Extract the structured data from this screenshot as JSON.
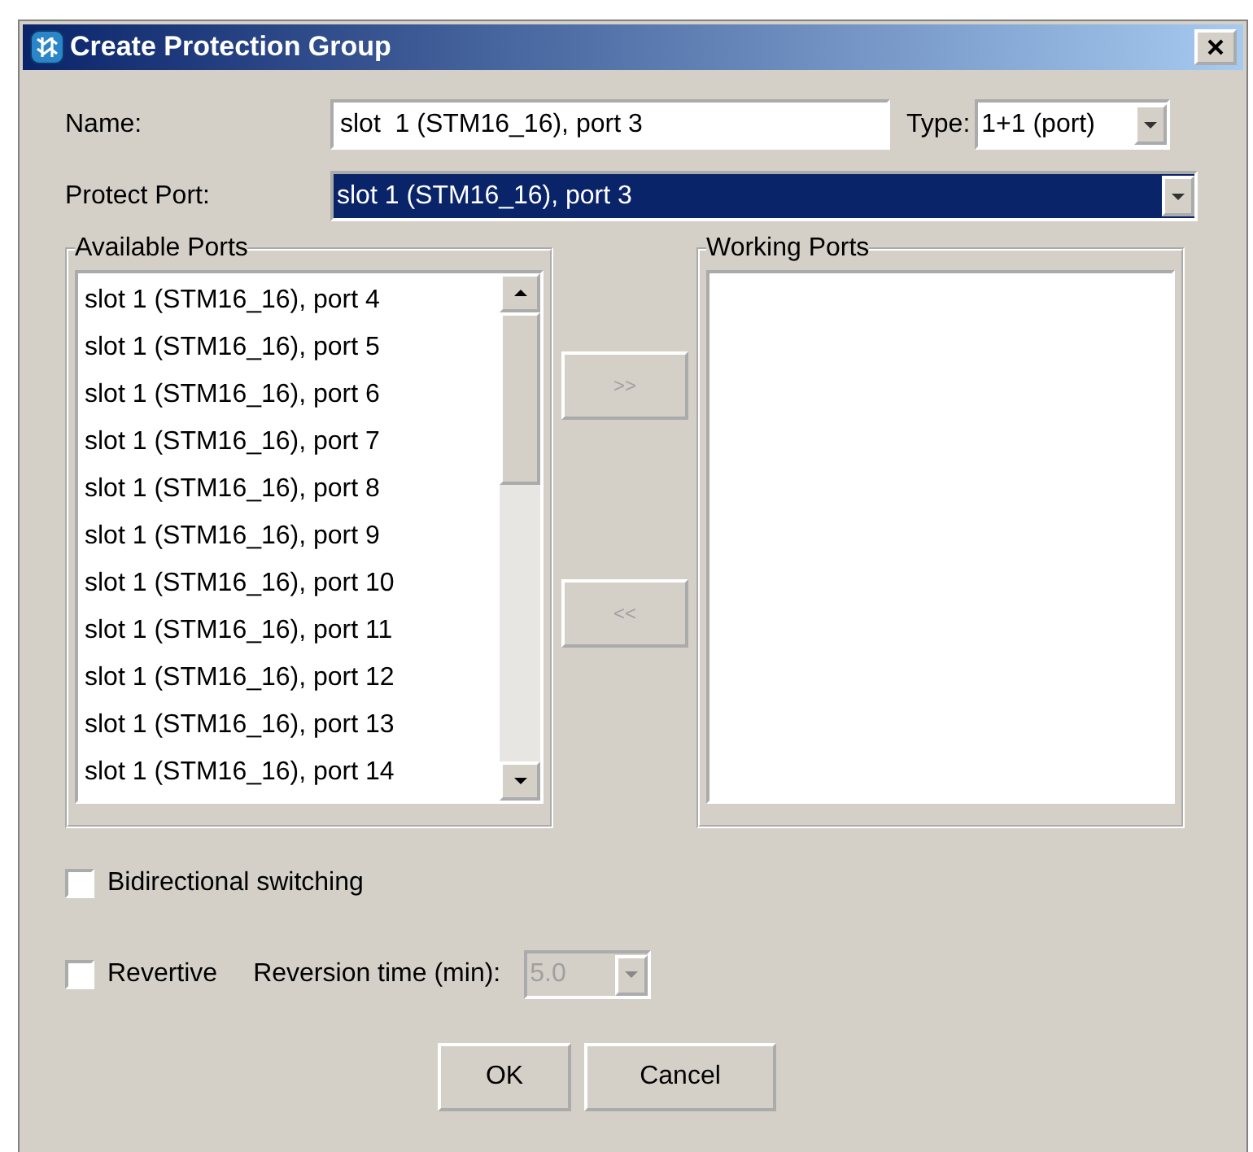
{
  "window": {
    "title": "Create Protection Group"
  },
  "name_field": {
    "label": "Name:",
    "value": "slot  1 (STM16_16), port 3"
  },
  "type_field": {
    "label": "Type:",
    "value": "1+1 (port)"
  },
  "protect_port": {
    "label": "Protect Port:",
    "value": "slot  1 (STM16_16), port 3",
    "selected": true
  },
  "available_ports": {
    "title": "Available Ports",
    "items": [
      {
        "label": "slot  1 (STM16_16), port 4"
      },
      {
        "label": "slot  1 (STM16_16), port 5"
      },
      {
        "label": "slot  1 (STM16_16), port 6"
      },
      {
        "label": "slot  1 (STM16_16), port 7"
      },
      {
        "label": "slot  1 (STM16_16), port 8"
      },
      {
        "label": "slot  1 (STM16_16), port 9"
      },
      {
        "label": "slot  1 (STM16_16), port 10"
      },
      {
        "label": "slot  1 (STM16_16), port 11"
      },
      {
        "label": "slot  1 (STM16_16), port 12"
      },
      {
        "label": "slot  1 (STM16_16), port 13"
      },
      {
        "label": "slot  1 (STM16_16), port 14"
      }
    ]
  },
  "move_buttons": [
    {
      "label": ">>",
      "disabled": true
    },
    {
      "label": "<<",
      "disabled": true
    }
  ],
  "working_ports": {
    "title": "Working Ports"
  },
  "bidirectional": {
    "label": "Bidirectional switching",
    "checked": false
  },
  "revertive": {
    "label": "Revertive",
    "checked": false
  },
  "reversion_time": {
    "label": "Reversion time (min):",
    "value": "5.0",
    "disabled": true
  },
  "buttons": [
    "OK",
    "Cancel"
  ]
}
